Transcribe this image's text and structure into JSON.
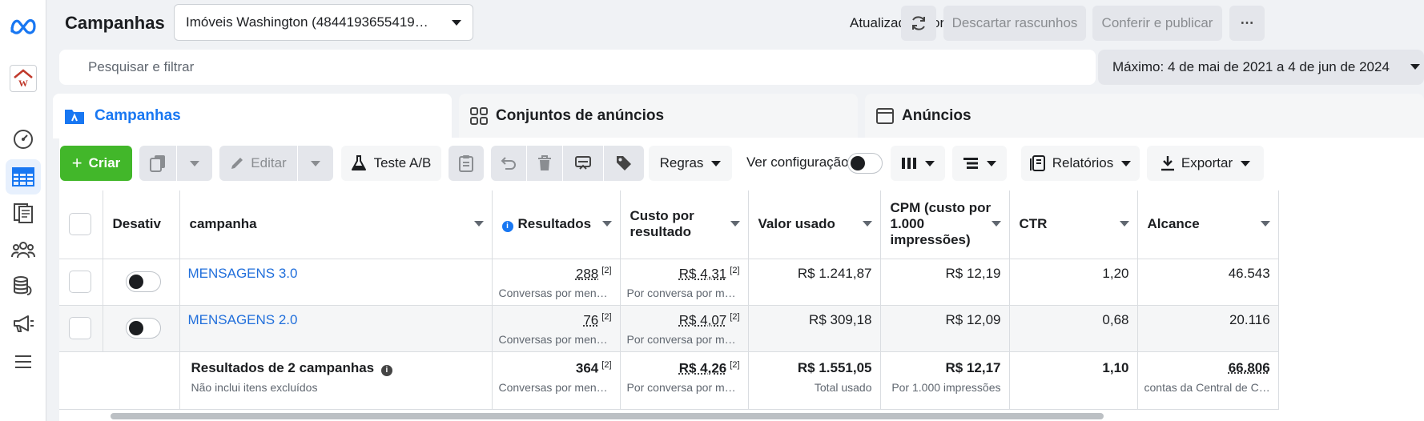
{
  "header": {
    "title": "Campanhas",
    "account": "Imóveis Washington (4844193655419…",
    "updated": "Atualizado agora mesmo",
    "discard": "Descartar rascunhos",
    "publish": "Conferir e publicar",
    "more": "⋯"
  },
  "search": {
    "placeholder": "Pesquisar e filtrar"
  },
  "date_range": "Máximo: 4 de mai de 2021 a 4 de jun de 2024",
  "tabs": [
    {
      "label": "Campanhas"
    },
    {
      "label": "Conjuntos de anúncios"
    },
    {
      "label": "Anúncios"
    }
  ],
  "toolbar": {
    "create": "Criar",
    "edit": "Editar",
    "ab_test": "Teste A/B",
    "rules": "Regras",
    "view_setup": "Ver configuração",
    "reports": "Relatórios",
    "export": "Exportar"
  },
  "table": {
    "columns": {
      "off": "Desativ",
      "campaign": "campanha",
      "results": "Resultados",
      "cost": "Custo por resultado",
      "spent": "Valor usado",
      "cpm": "CPM (custo por 1.000 impressões)",
      "ctr": "CTR",
      "reach": "Alcance"
    },
    "rows": [
      {
        "name": "MENSAGENS 3.0",
        "results": "288",
        "results_sub": "Conversas por men…",
        "cost": "R$ 4,31",
        "cost_sub": "Por conversa por m…",
        "spent": "R$ 1.241,87",
        "cpm": "R$ 12,19",
        "ctr": "1,20",
        "reach": "46.543"
      },
      {
        "name": "MENSAGENS 2.0",
        "results": "76",
        "results_sub": "Conversas por men…",
        "cost": "R$ 4,07",
        "cost_sub": "Por conversa por m…",
        "spent": "R$ 309,18",
        "cpm": "R$ 12,09",
        "ctr": "0,68",
        "reach": "20.116"
      }
    ],
    "footnote": "[2]",
    "summary": {
      "label": "Resultados de 2 campanhas",
      "note": "Não inclui itens excluídos",
      "results": "364",
      "results_sub": "Conversas por men…",
      "cost": "R$ 4,26",
      "cost_sub": "Por conversa por m…",
      "spent": "R$ 1.551,05",
      "spent_sub": "Total usado",
      "cpm": "R$ 12,17",
      "cpm_sub": "Por 1.000 impressões",
      "ctr": "1,10",
      "reach": "66.806",
      "reach_sub": "contas da Central de C…"
    }
  },
  "colors": {
    "accent": "#216fdb",
    "create": "#42b72a"
  }
}
